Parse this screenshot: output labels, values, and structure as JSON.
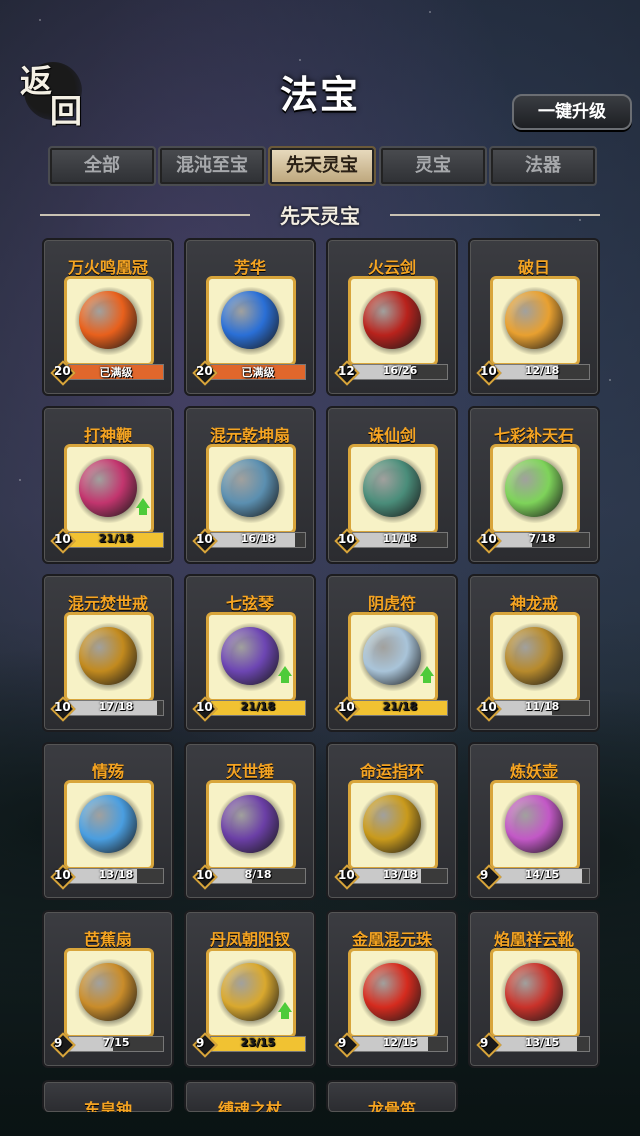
{
  "header": {
    "back_label_top": "返",
    "back_label_bottom": "回",
    "title": "法宝",
    "upgrade_all_label": "一键升级"
  },
  "tabs": [
    {
      "label": "全部",
      "active": false
    },
    {
      "label": "混沌至宝",
      "active": false
    },
    {
      "label": "先天灵宝",
      "active": true
    },
    {
      "label": "灵宝",
      "active": false
    },
    {
      "label": "法器",
      "active": false
    }
  ],
  "section": {
    "title": "先天灵宝"
  },
  "colors": {
    "accent_gold": "#d8a53b",
    "name_orange": "#f5a422",
    "bar_full": "#e0672c",
    "bar_ready": "#f1c232",
    "bar_normal": "#c9c9c9",
    "upgrade_arrow": "#4ecb3a"
  },
  "items": [
    {
      "name": "万火鸣凰冠",
      "level": "20",
      "progress": "已满级",
      "ratio": 1.0,
      "state": "max",
      "icon": "phoenix-crown-icon",
      "color": "#e8601c",
      "upgradable": false
    },
    {
      "name": "芳华",
      "level": "20",
      "progress": "已满级",
      "ratio": 1.0,
      "state": "max",
      "icon": "blue-orb-icon",
      "color": "#2a6fd6",
      "upgradable": false
    },
    {
      "name": "火云剑",
      "level": "12",
      "progress": "16/26",
      "ratio": 0.62,
      "state": "normal",
      "icon": "fire-sword-icon",
      "color": "#b8221c",
      "upgradable": false
    },
    {
      "name": "破日",
      "level": "10",
      "progress": "12/18",
      "ratio": 0.67,
      "state": "normal",
      "icon": "sun-breaker-icon",
      "color": "#e8a030",
      "upgradable": false
    },
    {
      "name": "打神鞭",
      "level": "10",
      "progress": "21/18",
      "ratio": 1.0,
      "state": "ready",
      "icon": "god-whip-icon",
      "color": "#c2356e",
      "upgradable": true
    },
    {
      "name": "混元乾坤扇",
      "level": "10",
      "progress": "16/18",
      "ratio": 0.89,
      "state": "normal",
      "icon": "yinyang-fan-icon",
      "color": "#5b8fb0",
      "upgradable": false
    },
    {
      "name": "诛仙剑",
      "level": "10",
      "progress": "11/18",
      "ratio": 0.61,
      "state": "normal",
      "icon": "immortal-sword-icon",
      "color": "#4a8d7a",
      "upgradable": false
    },
    {
      "name": "七彩补天石",
      "level": "10",
      "progress": "7/18",
      "ratio": 0.39,
      "state": "normal",
      "icon": "rainbow-stone-icon",
      "color": "#7ed35a",
      "upgradable": false
    },
    {
      "name": "混元焚世戒",
      "level": "10",
      "progress": "17/18",
      "ratio": 0.94,
      "state": "normal",
      "icon": "fire-ring-icon",
      "color": "#c28a1e",
      "upgradable": false
    },
    {
      "name": "七弦琴",
      "level": "10",
      "progress": "21/18",
      "ratio": 1.0,
      "state": "ready",
      "icon": "zither-icon",
      "color": "#6d46b3",
      "upgradable": true
    },
    {
      "name": "阴虎符",
      "level": "10",
      "progress": "21/18",
      "ratio": 1.0,
      "state": "ready",
      "icon": "tiger-talisman-icon",
      "color": "#a9c4d9",
      "upgradable": true
    },
    {
      "name": "神龙戒",
      "level": "10",
      "progress": "11/18",
      "ratio": 0.61,
      "state": "normal",
      "icon": "dragon-ring-icon",
      "color": "#b78a2c",
      "upgradable": false
    },
    {
      "name": "情殇",
      "level": "10",
      "progress": "13/18",
      "ratio": 0.72,
      "state": "normal",
      "icon": "crystal-blade-icon",
      "color": "#4a9ee0",
      "upgradable": false
    },
    {
      "name": "灭世锤",
      "level": "10",
      "progress": "8/18",
      "ratio": 0.44,
      "state": "normal",
      "icon": "doom-hammer-icon",
      "color": "#6b3fa6",
      "upgradable": false
    },
    {
      "name": "命运指环",
      "level": "10",
      "progress": "13/18",
      "ratio": 0.72,
      "state": "normal",
      "icon": "fate-ring-icon",
      "color": "#c99a1c",
      "upgradable": false
    },
    {
      "name": "炼妖壶",
      "level": "9",
      "progress": "14/15",
      "ratio": 0.93,
      "state": "normal",
      "icon": "teapot-icon",
      "color": "#c258c6",
      "upgradable": false
    },
    {
      "name": "芭蕉扇",
      "level": "9",
      "progress": "7/15",
      "ratio": 0.47,
      "state": "normal",
      "icon": "banana-fan-icon",
      "color": "#c98c2a",
      "upgradable": false
    },
    {
      "name": "丹凤朝阳钗",
      "level": "9",
      "progress": "23/15",
      "ratio": 1.0,
      "state": "ready",
      "icon": "phoenix-hairpin-icon",
      "color": "#d9a82e",
      "upgradable": true
    },
    {
      "name": "金凰混元珠",
      "level": "9",
      "progress": "12/15",
      "ratio": 0.8,
      "state": "normal",
      "icon": "golden-pearl-icon",
      "color": "#d52b1e",
      "upgradable": false
    },
    {
      "name": "焰凰祥云靴",
      "level": "9",
      "progress": "13/15",
      "ratio": 0.87,
      "state": "normal",
      "icon": "cloud-boots-icon",
      "color": "#c9322a",
      "upgradable": false
    }
  ],
  "partial_items": [
    {
      "name": "东皇钟"
    },
    {
      "name": "缚魂之杖"
    },
    {
      "name": "龙骨笛"
    }
  ]
}
